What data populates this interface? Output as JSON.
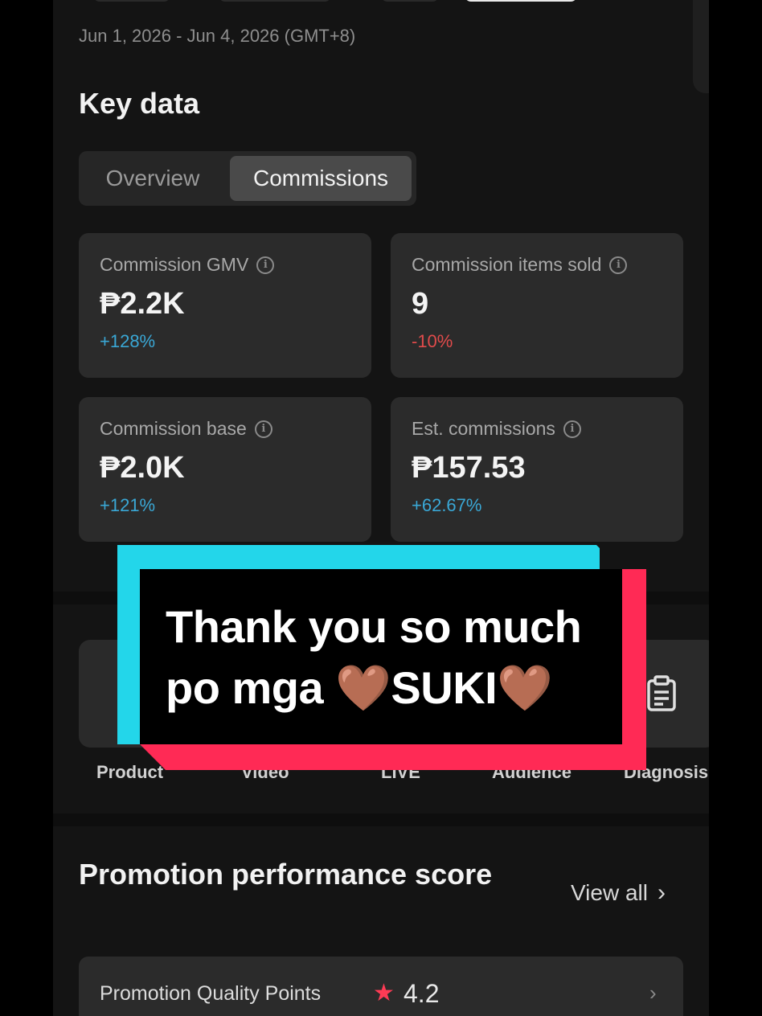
{
  "header": {
    "date_range": "Jun 1, 2026 - Jun 4, 2026 (GMT+8)"
  },
  "key_data": {
    "title": "Key data",
    "tabs": [
      {
        "label": "Overview",
        "selected": false
      },
      {
        "label": "Commissions",
        "selected": true
      }
    ],
    "cards": [
      {
        "label": "Commission GMV",
        "value": "₱2.2K",
        "change": "+128%",
        "trend": "up"
      },
      {
        "label": "Commission items sold",
        "value": "9",
        "change": "-10%",
        "trend": "down"
      },
      {
        "label": "Commission base",
        "value": "₱2.0K",
        "change": "+121%",
        "trend": "up"
      },
      {
        "label": "Est. commissions",
        "value": "₱157.53",
        "change": "+62.67%",
        "trend": "up"
      }
    ]
  },
  "tools": [
    {
      "label": "Product",
      "icon": "product-icon"
    },
    {
      "label": "Video",
      "icon": "video-icon"
    },
    {
      "label": "LIVE",
      "icon": "live-icon"
    },
    {
      "label": "Audience",
      "icon": "audience-icon"
    },
    {
      "label": "Diagnosis",
      "icon": "clipboard-icon"
    }
  ],
  "promotion": {
    "title": "Promotion performance score",
    "view_all": "View all",
    "quality_label": "Promotion Quality Points",
    "quality_score": "4.2"
  },
  "caption": {
    "line1": "Thank you so much",
    "line2_prefix": "po mga ",
    "line2_word": "SUKI",
    "heart": "🤎"
  },
  "colors": {
    "positive": "#3aa8d6",
    "negative": "#e14b4b",
    "star": "#ff3b55",
    "caption_cyan": "#23d6ea",
    "caption_pink": "#ff2a55"
  }
}
